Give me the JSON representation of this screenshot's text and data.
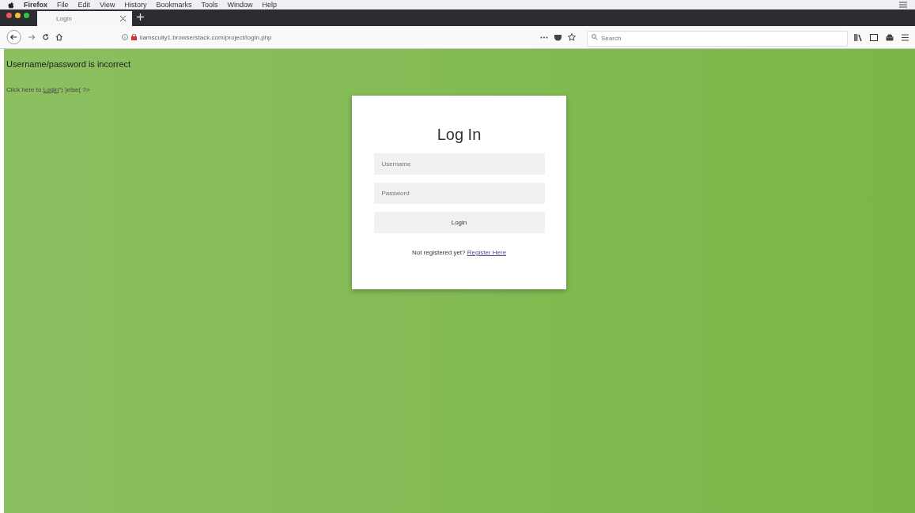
{
  "menu_bar": {
    "items": [
      "Firefox",
      "File",
      "Edit",
      "View",
      "History",
      "Bookmarks",
      "Tools",
      "Window",
      "Help"
    ]
  },
  "tabs": [
    {
      "label": "Login",
      "selected": true
    }
  ],
  "address_bar": {
    "url": "liamscully1.browserstack.com/project/login.php"
  },
  "search": {
    "placeholder": "Search"
  },
  "page": {
    "error": "Username/password is incorrect",
    "hint_before": "Click here to",
    "hint_link": "Login",
    "hint_after": "\") }else{ ?>",
    "form": {
      "title": "Log In",
      "username_placeholder": "Username",
      "password_placeholder": "Password",
      "button": "Login",
      "register_text": "Not registered yet?",
      "register_link": "Register Here"
    }
  }
}
